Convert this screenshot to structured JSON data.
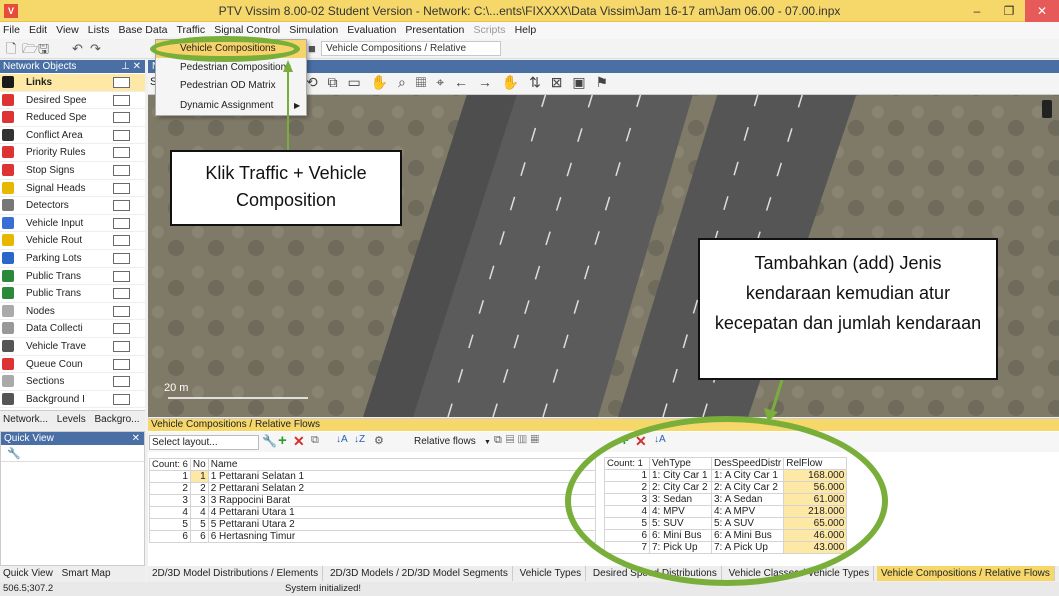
{
  "window": {
    "title": "PTV Vissim 8.00-02 Student Version - Network: C:\\...ents\\FIXXXX\\Data Vissim\\Jam 16-17 am\\Jam 06.00 - 07.00.inpx"
  },
  "menu": [
    "File",
    "Edit",
    "View",
    "Lists",
    "Base Data",
    "Traffic",
    "Signal Control",
    "Simulation",
    "Evaluation",
    "Presentation",
    "Scripts",
    "Help"
  ],
  "toolbar": {
    "combo": "Vehicle Compositions / Relative"
  },
  "traffic_menu": [
    "Vehicle Compositions",
    "Pedestrian Compositions",
    "Pedestrian OD Matrix",
    "Dynamic Assignment"
  ],
  "network_objects": {
    "title": "Network Objects",
    "items": [
      {
        "label": "Links",
        "icon": "links-icon",
        "color": "#1a1a1a"
      },
      {
        "label": "Desired Spee",
        "icon": "speed-sign-icon",
        "color": "#d33"
      },
      {
        "label": "Reduced Spe",
        "icon": "warning-triangle-icon",
        "color": "#d33"
      },
      {
        "label": "Conflict Area",
        "icon": "conflict-area-icon",
        "color": "#333"
      },
      {
        "label": "Priority Rules",
        "icon": "priority-triangle-icon",
        "color": "#d33"
      },
      {
        "label": "Stop Signs",
        "icon": "stop-sign-icon",
        "color": "#d33"
      },
      {
        "label": "Signal Heads",
        "icon": "signal-head-icon",
        "color": "#e6b800"
      },
      {
        "label": "Detectors",
        "icon": "detector-icon",
        "color": "#777"
      },
      {
        "label": "Vehicle Input",
        "icon": "vehicle-input-icon",
        "color": "#3a6ed6"
      },
      {
        "label": "Vehicle Rout",
        "icon": "vehicle-route-icon",
        "color": "#e6b800"
      },
      {
        "label": "Parking Lots",
        "icon": "parking-icon",
        "color": "#2a67c9"
      },
      {
        "label": "Public Trans",
        "icon": "transit-stop-icon",
        "color": "#2a8a3a"
      },
      {
        "label": "Public Trans",
        "icon": "transit-line-icon",
        "color": "#2a8a3a"
      },
      {
        "label": "Nodes",
        "icon": "nodes-icon",
        "color": "#aaa"
      },
      {
        "label": "Data Collecti",
        "icon": "data-collection-icon",
        "color": "#999"
      },
      {
        "label": "Vehicle Trave",
        "icon": "travel-time-icon",
        "color": "#555"
      },
      {
        "label": "Queue Coun",
        "icon": "queue-counter-icon",
        "color": "#d33"
      },
      {
        "label": "Sections",
        "icon": "sections-icon",
        "color": "#aaa"
      },
      {
        "label": "Background I",
        "icon": "background-image-icon",
        "color": "#555"
      }
    ]
  },
  "left_tabs": [
    "Network...",
    "Levels",
    "Backgro..."
  ],
  "quick_view": {
    "title": "Quick View"
  },
  "left_bottom_tabs": [
    "Quick View",
    "Smart Map"
  ],
  "map": {
    "scale": "20 m"
  },
  "callouts": {
    "traffic": "Klik Traffic + Vehicle Composition",
    "add": "Tambahkan (add) Jenis kendaraan kemudian atur kecepatan dan jumlah kendaraan"
  },
  "flows": {
    "title": "Vehicle Compositions / Relative Flows",
    "select_layout": "Select layout...",
    "relative_flows": "Relative flows",
    "left_count": "Count: 6",
    "left_headers": [
      "No",
      "Name"
    ],
    "compositions": [
      {
        "no": "1",
        "name": "1 Pettarani Selatan 1"
      },
      {
        "no": "2",
        "name": "2 Pettarani Selatan 2"
      },
      {
        "no": "3",
        "name": "3 Rappocini Barat"
      },
      {
        "no": "4",
        "name": "4 Pettarani Utara 1"
      },
      {
        "no": "5",
        "name": "5 Pettarani Utara 2"
      },
      {
        "no": "6",
        "name": "6 Hertasning Timur"
      }
    ],
    "right_count": "Count: 1",
    "right_headers": [
      "VehType",
      "DesSpeedDistr",
      "RelFlow"
    ],
    "rel_rows": [
      {
        "n": "1",
        "veh": "1: City Car 1",
        "des": "1: A City Car 1",
        "flow": "168.000"
      },
      {
        "n": "2",
        "veh": "2: City Car 2",
        "des": "2: A City Car 2",
        "flow": "56.000"
      },
      {
        "n": "3",
        "veh": "3: Sedan",
        "des": "3: A Sedan",
        "flow": "61.000"
      },
      {
        "n": "4",
        "veh": "4: MPV",
        "des": "4: A MPV",
        "flow": "218.000"
      },
      {
        "n": "5",
        "veh": "5: SUV",
        "des": "5: A SUV",
        "flow": "65.000"
      },
      {
        "n": "6",
        "veh": "6: Mini Bus",
        "des": "6: A Mini Bus",
        "flow": "46.000"
      },
      {
        "n": "7",
        "veh": "7: Pick Up",
        "des": "7: A Pick Up",
        "flow": "43.000"
      }
    ]
  },
  "bottom_tabs": [
    "2D/3D Model Distributions / Elements",
    "2D/3D Models / 2D/3D Model Segments",
    "Vehicle Types",
    "Desired Speed Distributions",
    "Vehicle Classes / Vehicle Types",
    "Vehicle Compositions / Relative Flows"
  ],
  "status": {
    "coords": "506.5;307.2",
    "message": "System initialized!"
  }
}
